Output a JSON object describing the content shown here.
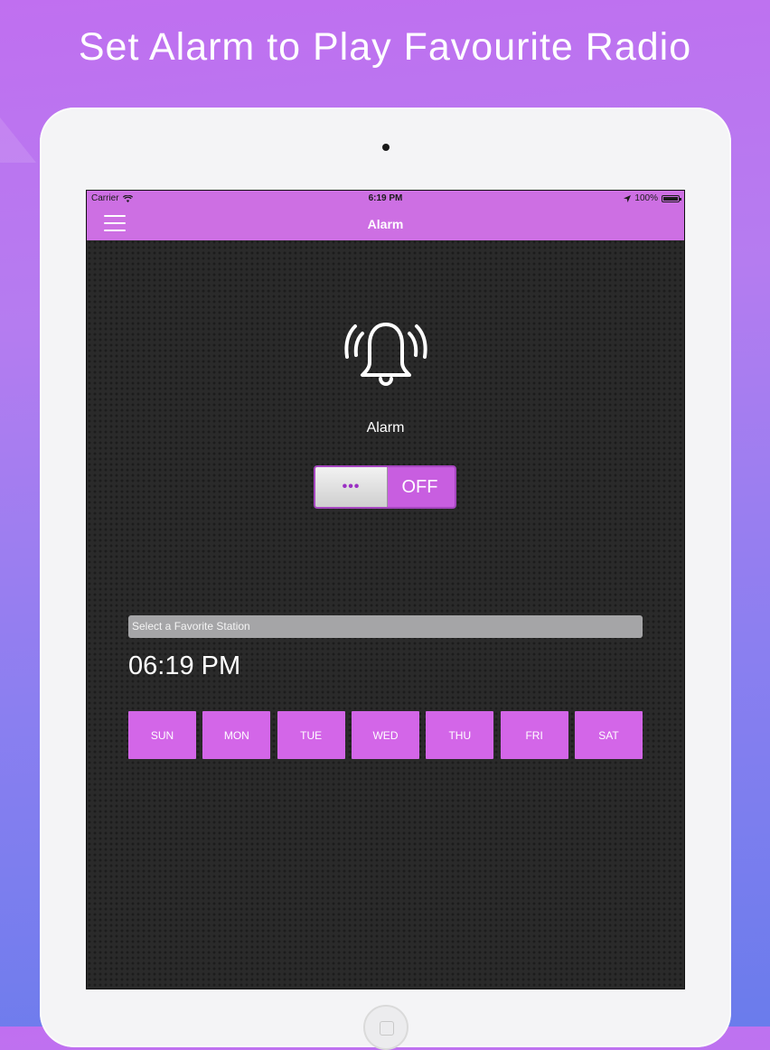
{
  "headline": "Set Alarm to Play Favourite Radio",
  "status_bar": {
    "carrier": "Carrier",
    "time": "6:19 PM",
    "battery": "100%"
  },
  "nav": {
    "title": "Alarm"
  },
  "alarm": {
    "label": "Alarm",
    "toggle_knob": "•••",
    "toggle_state": "OFF"
  },
  "station": {
    "placeholder": "Select a Favorite Station"
  },
  "time": "06:19 PM",
  "days": [
    "SUN",
    "MON",
    "TUE",
    "WED",
    "THU",
    "FRI",
    "SAT"
  ],
  "colors": {
    "accent": "#cd6fe3",
    "day_button": "#d366e8",
    "screen_bg": "#2a2a2a"
  }
}
